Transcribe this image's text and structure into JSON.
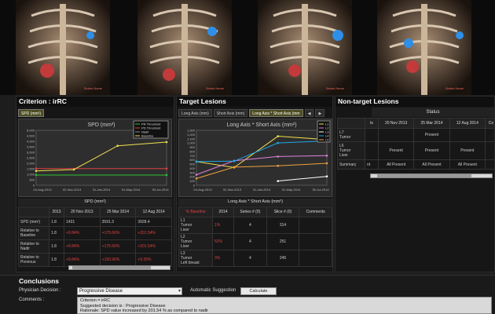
{
  "images": [
    {
      "label": "Series Name"
    },
    {
      "label": "Series Name"
    },
    {
      "label": "Series Name"
    },
    {
      "label": "Series Name"
    }
  ],
  "criterion": {
    "title": "Criterion : irRC",
    "tab": "SPD (mm²)",
    "chart_title": "SPD (mm²)",
    "legend": [
      "PR Threshold",
      "PD Threshold",
      "Nadir",
      "Baseline"
    ],
    "table_title": "SPD (mm²)",
    "headers": [
      "",
      "2013",
      "20 Nov 2013",
      "25 Mar 2014",
      "12 Aug 2014"
    ],
    "rows": [
      {
        "label": "SPD (mm²)",
        "cells": [
          "1.8",
          "1431",
          "3591.3",
          "3928.4"
        ]
      },
      {
        "label": "Relative to Baseline",
        "cells": [
          "1.8",
          "+9.84%",
          "+175.66%",
          "+201.54%"
        ]
      },
      {
        "label": "Relative to Nadir",
        "cells": [
          "1.8",
          "+9.84%",
          "+175.66%",
          "+201.54%"
        ]
      },
      {
        "label": "Relative to Previous",
        "cells": [
          "1.8",
          "+9.84%",
          "+150.96%",
          "+9.39%"
        ]
      }
    ]
  },
  "target": {
    "title": "Target Lesions",
    "tabs": [
      "Long Axis (mm)",
      "Short Axis (mm)",
      "Long Axis * Short Axis (mm"
    ],
    "chart_title": "Long Axis * Short Axis (mm²)",
    "legend": [
      "L1",
      "L2",
      "L3",
      "L4",
      "L5"
    ],
    "table_title": "Long Axis * Short Axis (mm²)",
    "headers": [
      "% Baseline",
      "2014",
      "Series # (0)",
      "Slice # (0)",
      "Comments"
    ],
    "rows": [
      {
        "label": "L1\nTumor\nLiver",
        "cells": [
          "1%",
          "4",
          "314",
          ""
        ]
      },
      {
        "label": "L2\nTumor\nLiver",
        "cells": [
          "52%",
          "4",
          "251",
          ""
        ]
      },
      {
        "label": "L3\nTumor\nLeft breast",
        "cells": [
          "3%",
          "4",
          "245",
          ""
        ]
      }
    ]
  },
  "nontarget": {
    "title": "Non-target Lesions",
    "status_header": "Status",
    "headers": [
      "",
      "ts",
      "20 Nov 2013",
      "25 Mar 2014",
      "12 Aug 2014",
      "Co"
    ],
    "rows": [
      {
        "label": "L7\nTumor",
        "cells": [
          "",
          "",
          "Present",
          "",
          ""
        ]
      },
      {
        "label": "L6\nTumor\nLiver",
        "cells": [
          "",
          "Present",
          "Present",
          "Present",
          ""
        ]
      },
      {
        "label": "Summary",
        "cells": [
          "nt",
          "All Present",
          "All Present",
          "All Present",
          ""
        ]
      }
    ]
  },
  "conclusions": {
    "title": "Conclusions",
    "decision_label": "Physician Decision :",
    "decision_value": "Progressive Disease",
    "auto_label": "Automatic Suggestion",
    "calc_button": "Calculate",
    "comments_label": "Comments :",
    "comments": [
      "Criterion = irRC",
      "Suggested decision is : Progressive Disease",
      "Rationale: SPD value increased by 201.54 % as compared to nadir"
    ]
  },
  "colors": {
    "red": "#e04040",
    "yellow": "#f0e050",
    "green": "#30c030",
    "cyan": "#20a8e8"
  },
  "chart_data": [
    {
      "type": "line",
      "title": "SPD (mm²)",
      "x": [
        "04-Aug-2013",
        "02-Nov-2013",
        "31-Jan-2014",
        "01-May-2014",
        "30-Jul-2014"
      ],
      "ylim": [
        0,
        5000
      ],
      "yticks": [
        0,
        500,
        1000,
        1500,
        2000,
        2500,
        3000,
        3500,
        4000,
        4500,
        5000
      ],
      "series": [
        {
          "name": "PR Threshold",
          "points": [
            [
              "2013-08-04",
              930
            ],
            [
              "2014-08-12",
              930
            ]
          ]
        },
        {
          "name": "PD Threshold",
          "points": [
            [
              "2013-08-04",
              1520
            ],
            [
              "2014-08-12",
              1520
            ]
          ]
        },
        {
          "name": "Nadir",
          "points": []
        },
        {
          "name": "Baseline",
          "points": [
            [
              "2013-08-04",
              1302
            ],
            [
              "2013-11-20",
              1431
            ],
            [
              "2014-03-25",
              3591
            ],
            [
              "2014-08-12",
              3928
            ]
          ]
        }
      ]
    },
    {
      "type": "line",
      "title": "Long Axis * Short Axis (mm²)",
      "x": [
        "04-Aug-2013",
        "02-Nov-2013",
        "31-Jan-2014",
        "01-May-2014",
        "30-Jul-2014"
      ],
      "ylim": [
        0,
        1300
      ],
      "yticks": [
        0,
        100,
        200,
        300,
        400,
        500,
        600,
        700,
        800,
        900,
        1000,
        1100,
        1200,
        1300
      ],
      "series": [
        {
          "name": "L1",
          "points": [
            [
              "2013-08-04",
              560
            ],
            [
              "2013-11-20",
              420
            ],
            [
              "2014-03-25",
              1160
            ],
            [
              "2014-08-12",
              1080
            ]
          ]
        },
        {
          "name": "L2",
          "points": [
            [
              "2013-08-04",
              250
            ],
            [
              "2013-11-20",
              580
            ],
            [
              "2014-03-25",
              680
            ],
            [
              "2014-08-12",
              700
            ]
          ]
        },
        {
          "name": "L3",
          "points": [
            [
              "2014-03-25",
              100
            ],
            [
              "2014-08-12",
              210
            ]
          ]
        },
        {
          "name": "L4",
          "points": [
            [
              "2013-08-04",
              560
            ],
            [
              "2013-11-20",
              570
            ],
            [
              "2014-03-25",
              1000
            ],
            [
              "2014-08-12",
              1050
            ]
          ]
        },
        {
          "name": "L5",
          "points": [
            [
              "2013-08-04",
              160
            ],
            [
              "2013-11-20",
              430
            ],
            [
              "2014-03-25",
              460
            ],
            [
              "2014-08-12",
              520
            ]
          ]
        }
      ]
    }
  ]
}
